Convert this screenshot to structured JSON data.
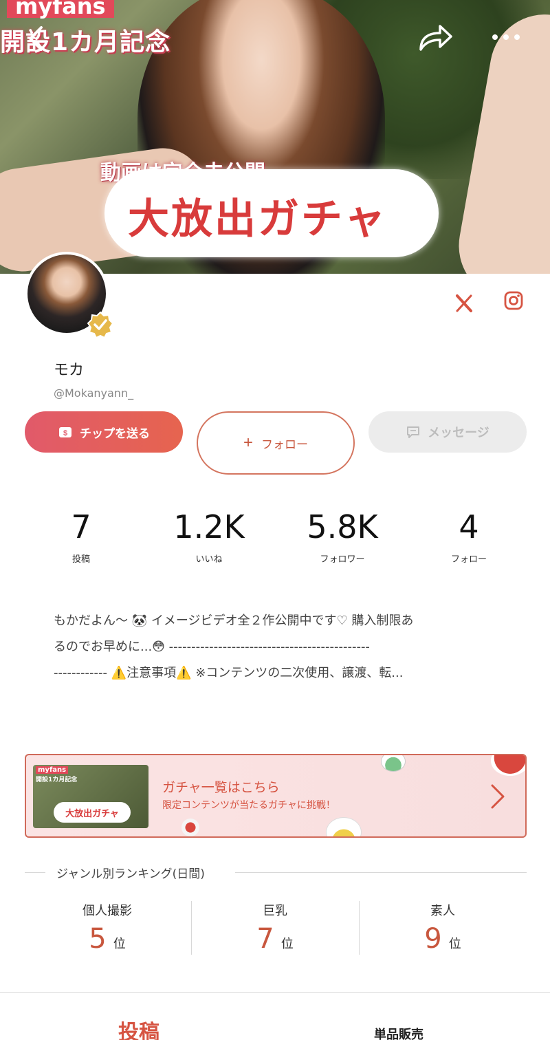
{
  "header": {
    "brand": "myfans",
    "brand_sub": "開設1カ月記念",
    "promo_sub": "動画は完全未公開",
    "promo_main": "大放出ガチャ"
  },
  "profile": {
    "name": "モカ",
    "handle": "@Mokanyann_"
  },
  "buttons": {
    "tip": "チップを送る",
    "follow": "フォロー",
    "message": "メッセージ"
  },
  "stats": [
    {
      "value": "7",
      "label": "投稿"
    },
    {
      "value": "1.2K",
      "label": "いいね"
    },
    {
      "value": "5.8K",
      "label": "フォロワー"
    },
    {
      "value": "4",
      "label": "フォロー"
    }
  ],
  "bio": {
    "line1": "もかだよん～ 🐼 イメージビデオ全２作公開中です♡ 購入制限あ",
    "line2": "るのでお早めに...😳 ---------------------------------------------",
    "line3": "------------ ⚠️注意事項⚠️ ※コンテンツの二次使用、譲渡、転..."
  },
  "gacha": {
    "thumb_tag": "myfans",
    "thumb_tag2": "開設1カ月記念",
    "thumb_pill": "大放出ガチャ",
    "title": "ガチャ一覧はこちら",
    "subtitle": "限定コンテンツが当たるガチャに挑戦！"
  },
  "ranking": {
    "heading": "ジャンル別ランキング(日間)",
    "items": [
      {
        "genre": "個人撮影",
        "rank": "5",
        "unit": "位"
      },
      {
        "genre": "巨乳",
        "rank": "7",
        "unit": "位"
      },
      {
        "genre": "素人",
        "rank": "9",
        "unit": "位"
      }
    ]
  },
  "tabs": {
    "posts": "投稿",
    "single": "単品販売"
  },
  "colors": {
    "accent": "#d65442",
    "tip_gradient_start": "#e15a6a",
    "tip_gradient_end": "#e6644f"
  }
}
